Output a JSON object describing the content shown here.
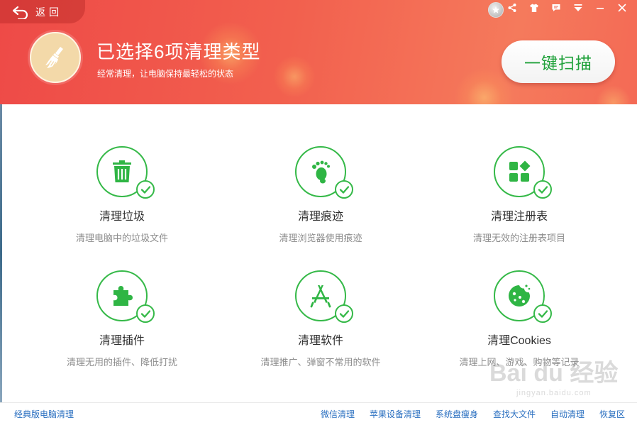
{
  "header": {
    "back_label": "返回",
    "title": "已选择6项清理类型",
    "subtitle": "经常清理，让电脑保持最轻松的状态",
    "scan_button": "一键扫描",
    "colors": {
      "bg_start": "#ee4a47",
      "bg_end": "#f57a5c",
      "scan_text": "#1fa13a"
    },
    "icons": [
      "medal-icon",
      "share-icon",
      "shirt-icon",
      "message-icon",
      "menu-icon",
      "minimize-icon",
      "close-icon"
    ]
  },
  "items": [
    {
      "name": "清理垃圾",
      "desc": "清理电脑中的垃圾文件",
      "icon": "trash-icon",
      "checked": true
    },
    {
      "name": "清理痕迹",
      "desc": "清理浏览器使用痕迹",
      "icon": "footprint-icon",
      "checked": true
    },
    {
      "name": "清理注册表",
      "desc": "清理无效的注册表项目",
      "icon": "registry-icon",
      "checked": true
    },
    {
      "name": "清理插件",
      "desc": "清理无用的插件、降低打扰",
      "icon": "puzzle-icon",
      "checked": true
    },
    {
      "name": "清理软件",
      "desc": "清理推广、弹窗不常用的软件",
      "icon": "app-store-icon",
      "checked": true
    },
    {
      "name": "清理Cookies",
      "desc": "清理上网、游戏、购物等记录",
      "icon": "cookie-icon",
      "checked": true
    }
  ],
  "footer": {
    "left_link": "经典版电脑清理",
    "links": [
      "微信清理",
      "苹果设备清理",
      "系统盘瘦身",
      "查找大文件",
      "自动清理",
      "恢复区"
    ]
  },
  "watermark": {
    "brand": "Bai du 经验",
    "url": "jingyan.baidu.com"
  },
  "theme": {
    "accent_green": "#35b948",
    "link_blue": "#2a6fc0"
  }
}
